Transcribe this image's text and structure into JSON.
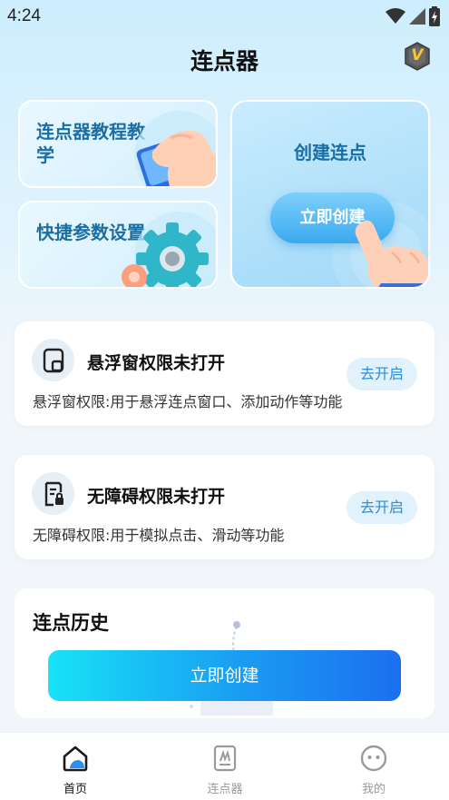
{
  "status_bar": {
    "time": "4:24",
    "icons": [
      "wifi-icon",
      "signal-icon",
      "battery-charging-icon"
    ]
  },
  "header": {
    "title": "连点器",
    "vip_icon": "vip-badge-icon",
    "vip_letter": "V"
  },
  "features": {
    "tutorial_label": "连点器教程教学",
    "settings_label": "快捷参数设置",
    "create_label": "创建连点",
    "create_button": "立即创建"
  },
  "permissions": [
    {
      "title": "悬浮窗权限未打开",
      "desc": "悬浮窗权限:用于悬浮连点窗口、添加动作等功能",
      "button": "去开启",
      "icon": "floating-window-icon"
    },
    {
      "title": "无障碍权限未打开",
      "desc": "无障碍权限:用于模拟点击、滑动等功能",
      "button": "去开启",
      "icon": "accessibility-icon"
    }
  ],
  "history": {
    "title": "连点历史",
    "create_button": "立即创建"
  },
  "nav": [
    {
      "label": "首页",
      "icon": "home-icon",
      "active": true
    },
    {
      "label": "连点器",
      "icon": "clicker-icon",
      "active": false
    },
    {
      "label": "我的",
      "icon": "profile-face-icon",
      "active": false
    }
  ],
  "colors": {
    "accent": "#2e8bd8",
    "card_text": "#1b6ea3",
    "gradient_start": "#17e2f7",
    "gradient_end": "#1b6ff0"
  }
}
